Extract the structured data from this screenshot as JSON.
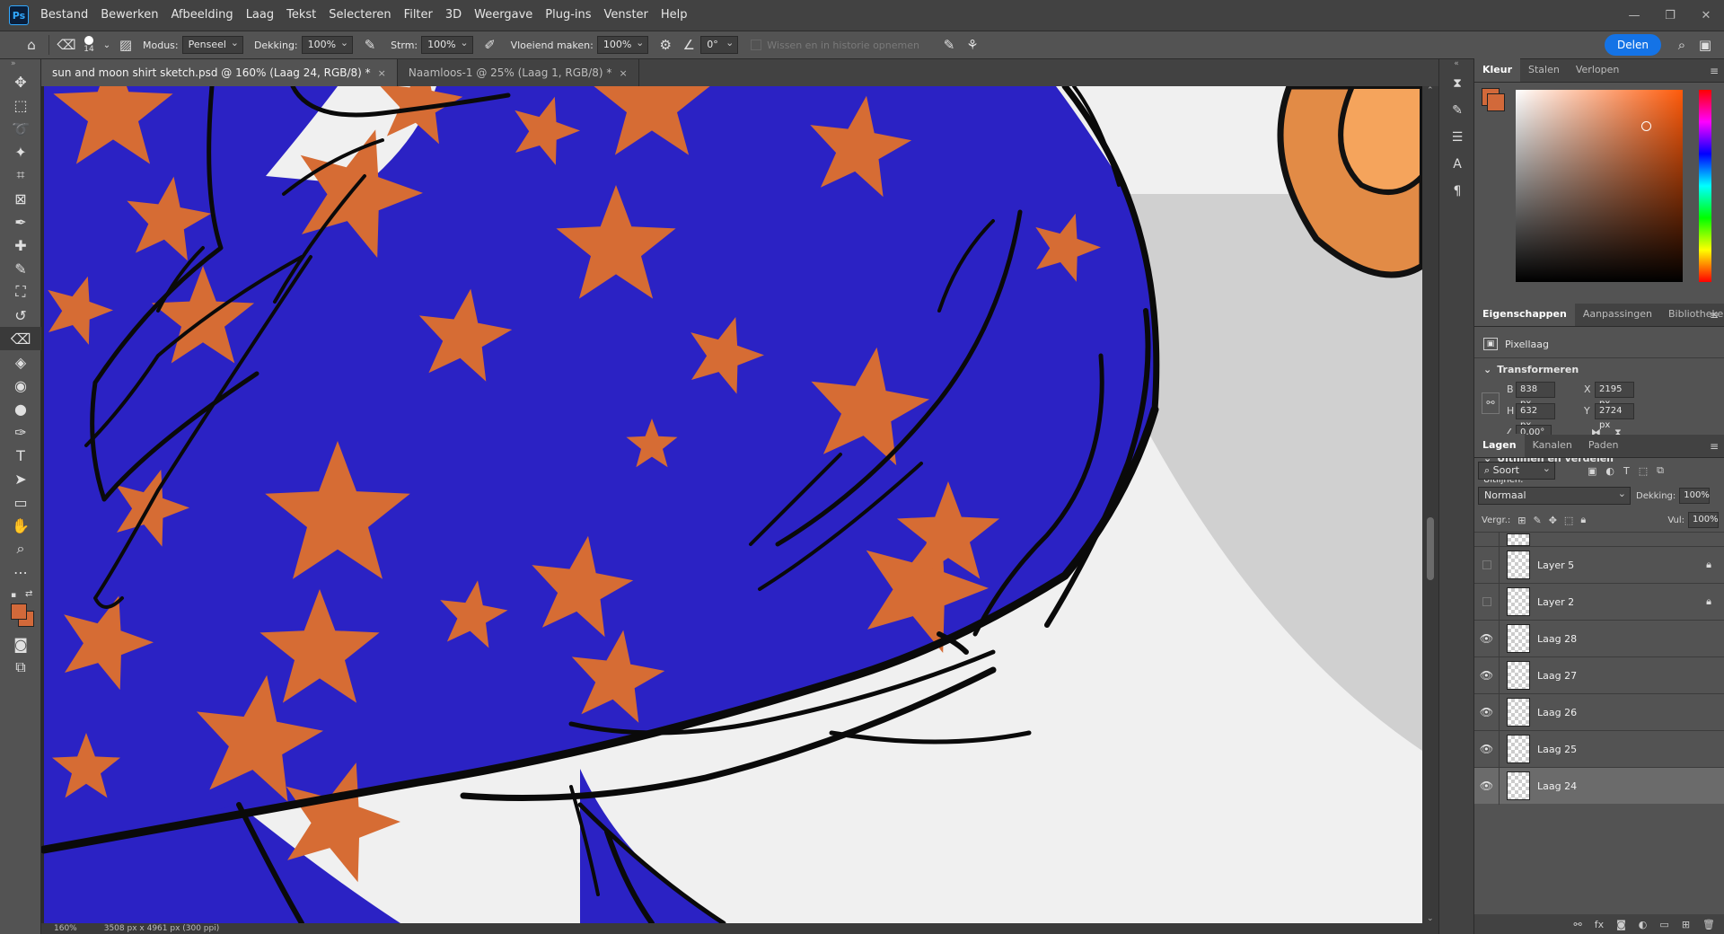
{
  "app": {
    "logo": "Ps"
  },
  "menu": [
    "Bestand",
    "Bewerken",
    "Afbeelding",
    "Laag",
    "Tekst",
    "Selecteren",
    "Filter",
    "3D",
    "Weergave",
    "Plug-ins",
    "Venster",
    "Help"
  ],
  "options": {
    "brush_size": "14",
    "mode_label": "Modus:",
    "mode_value": "Penseel",
    "opacity_label": "Dekking:",
    "opacity_value": "100%",
    "flow_label": "Strm:",
    "flow_value": "100%",
    "smoothing_label": "Vloeiend maken:",
    "smoothing_value": "100%",
    "angle_value": "0°",
    "erase_history_label": "Wissen en in historie opnemen",
    "share_label": "Delen"
  },
  "tabs": [
    {
      "label": "sun and moon shirt sketch.psd @ 160% (Laag 24, RGB/8) *",
      "close": "×"
    },
    {
      "label": "Naamloos-1 @ 25% (Laag 1, RGB/8) *",
      "close": "×"
    }
  ],
  "status": {
    "zoom": "160%",
    "doc_size": "3508 px x 4961 px (300 ppi)"
  },
  "colors": {
    "foreground": "#d2693a",
    "background": "#d2693a",
    "shirt": "#2b22c4",
    "star": "#d66c34",
    "canvas_bg": "#f0f0f0",
    "accent": "#1473e6"
  },
  "color_panel": {
    "tabs": [
      "Kleur",
      "Stalen",
      "Verlopen"
    ]
  },
  "properties_panel": {
    "tabs": [
      "Eigenschappen",
      "Aanpassingen",
      "Bibliotheken"
    ],
    "layer_type": "Pixellaag",
    "transform_title": "Transformeren",
    "w_label": "B",
    "w_value": "838 px",
    "h_label": "H",
    "h_value": "632 px",
    "x_label": "X",
    "x_value": "2195 px",
    "y_label": "Y",
    "y_value": "2724 px",
    "angle_value": "0,00°",
    "align_title": "Uitlijnen en verdelen",
    "align_label": "Uitlijnen:"
  },
  "layers_panel": {
    "tabs": [
      "Lagen",
      "Kanalen",
      "Paden"
    ],
    "filter_label": "Soort",
    "blend_mode": "Normaal",
    "opacity_label": "Dekking:",
    "opacity_value": "100%",
    "lock_label": "Vergr.:",
    "fill_label": "Vul:",
    "fill_value": "100%",
    "layers": [
      {
        "name": "Layer 5",
        "visible": false,
        "locked": true,
        "selected": false
      },
      {
        "name": "Layer 2",
        "visible": false,
        "locked": true,
        "selected": false
      },
      {
        "name": "Laag 28",
        "visible": true,
        "locked": false,
        "selected": false
      },
      {
        "name": "Laag 27",
        "visible": true,
        "locked": false,
        "selected": false
      },
      {
        "name": "Laag 26",
        "visible": true,
        "locked": false,
        "selected": false
      },
      {
        "name": "Laag 25",
        "visible": true,
        "locked": false,
        "selected": false
      },
      {
        "name": "Laag 24",
        "visible": true,
        "locked": false,
        "selected": true
      }
    ]
  },
  "tools": [
    "move-tool",
    "marquee-tool",
    "lasso-tool",
    "magic-wand-tool",
    "crop-tool",
    "frame-tool",
    "eyedropper-tool",
    "healing-brush-tool",
    "brush-tool",
    "clone-stamp-tool",
    "history-brush-tool",
    "eraser-tool",
    "paint-bucket-tool",
    "blur-tool",
    "dodge-tool",
    "pen-tool",
    "type-tool",
    "path-selection-tool",
    "rectangle-tool",
    "hand-tool",
    "zoom-tool",
    "more-tools"
  ]
}
